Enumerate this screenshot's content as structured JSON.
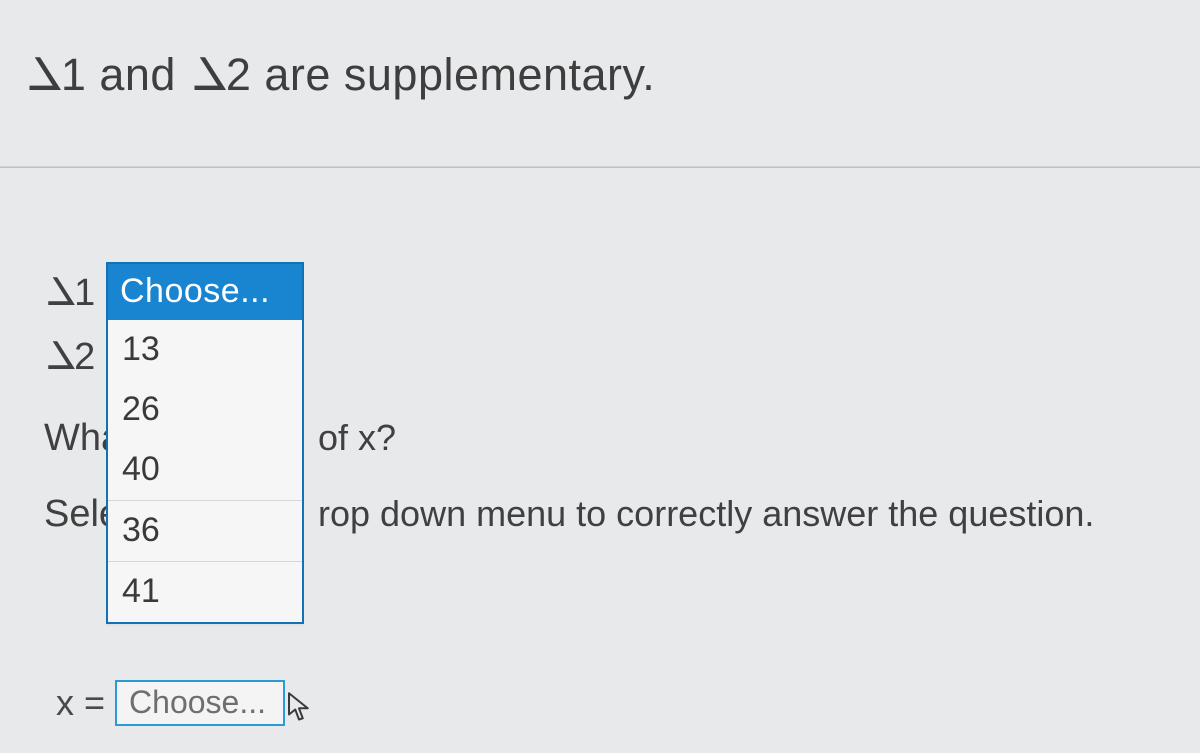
{
  "heading": {
    "angle_sym": "∠",
    "a1_label": "1",
    "mid1": " and ",
    "a2_label": "2",
    "tail": " are supplementary."
  },
  "rows": {
    "r1_lead_after": "1",
    "r2_lead_after": "2",
    "r3_lead": "Wha",
    "r3_trail": "of x?",
    "r4_lead": "Sele",
    "r4_trail": "rop down menu to correctly answer the question."
  },
  "dropdown": {
    "selected": "Choose...",
    "options": [
      "13",
      "26",
      "40",
      "36",
      "41"
    ]
  },
  "answer": {
    "lhs": "x =",
    "placeholder": "Choose..."
  }
}
